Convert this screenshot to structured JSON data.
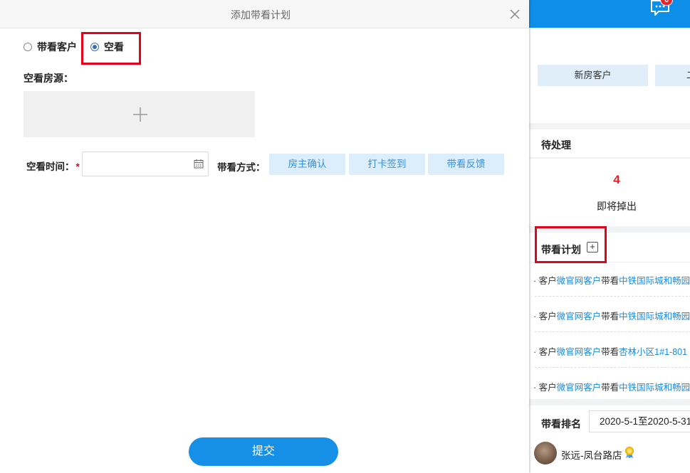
{
  "modal": {
    "title": "添加带看计划",
    "radio_options": [
      {
        "label": "带看客户",
        "checked": false
      },
      {
        "label": "空看",
        "checked": true
      }
    ],
    "source_label": "空看房源：",
    "time_label": "空看时间：",
    "required_mark": "*",
    "time_value": "",
    "method_label": "带看方式：",
    "method_buttons": [
      "房主确认",
      "打卡签到",
      "带看反馈"
    ],
    "submit_label": "提交",
    "highlight_color": "#e5001c"
  },
  "background": {
    "chat_badge": "6",
    "tabs": [
      "新房客户",
      "二"
    ],
    "pending": {
      "title": "待处理",
      "count": "4",
      "label": "即将掉出"
    },
    "plan": {
      "title": "带看计划",
      "add_icon": "+",
      "items": [
        {
          "prefix": "· 客户",
          "customer": "微官网客户",
          "mid": "带看",
          "property": "中铁国际城和畅园"
        },
        {
          "prefix": "· 客户",
          "customer": "微官网客户",
          "mid": "带看",
          "property": "中铁国际城和畅园"
        },
        {
          "prefix": "· 客户",
          "customer": "微官网客户",
          "mid": "带看",
          "property": "杏林小区1#1-801"
        },
        {
          "prefix": "· 客户",
          "customer": "微官网客户",
          "mid": "带看",
          "property": "中铁国际城和畅园"
        }
      ]
    },
    "ranking": {
      "title": "带看排名",
      "date_range": "2020-5-1至2020-5-31"
    },
    "agent": {
      "name": "张远-凤台路店",
      "badge_icon": "medal-icon"
    }
  },
  "colors": {
    "accent": "#1590e6",
    "topbar": "#0d8ee9",
    "link": "#1a8be0",
    "badge": "#e8222b"
  }
}
